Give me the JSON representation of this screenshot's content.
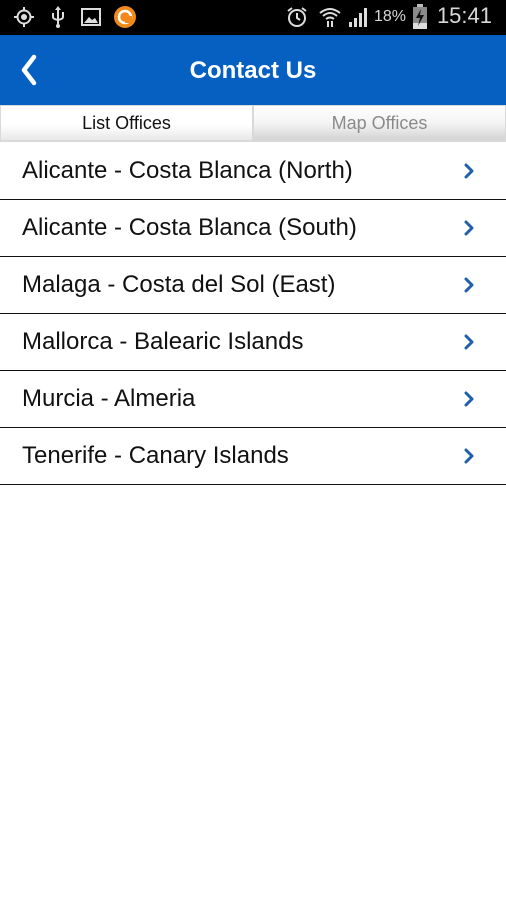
{
  "status_bar": {
    "left_icons": [
      "gps-icon",
      "usb-icon",
      "image-icon",
      "app-notification-icon"
    ],
    "right_icons": [
      "alarm-icon",
      "wifi-icon",
      "signal-icon",
      "battery-charging-icon"
    ],
    "battery_percent": "18%",
    "time": "15:41"
  },
  "header": {
    "title": "Contact Us",
    "back_icon": "chevron-left-icon"
  },
  "tabs": [
    {
      "label": "List Offices",
      "active": true
    },
    {
      "label": "Map Offices",
      "active": false
    }
  ],
  "offices": [
    {
      "label": "Alicante - Costa Blanca (North)"
    },
    {
      "label": "Alicante - Costa Blanca (South)"
    },
    {
      "label": "Malaga - Costa del Sol (East)"
    },
    {
      "label": "Mallorca - Balearic Islands"
    },
    {
      "label": "Murcia - Almeria"
    },
    {
      "label": "Tenerife - Canary Islands"
    }
  ],
  "colors": {
    "brand_blue": "#0560c2",
    "chevron_blue": "#1f5fae"
  }
}
